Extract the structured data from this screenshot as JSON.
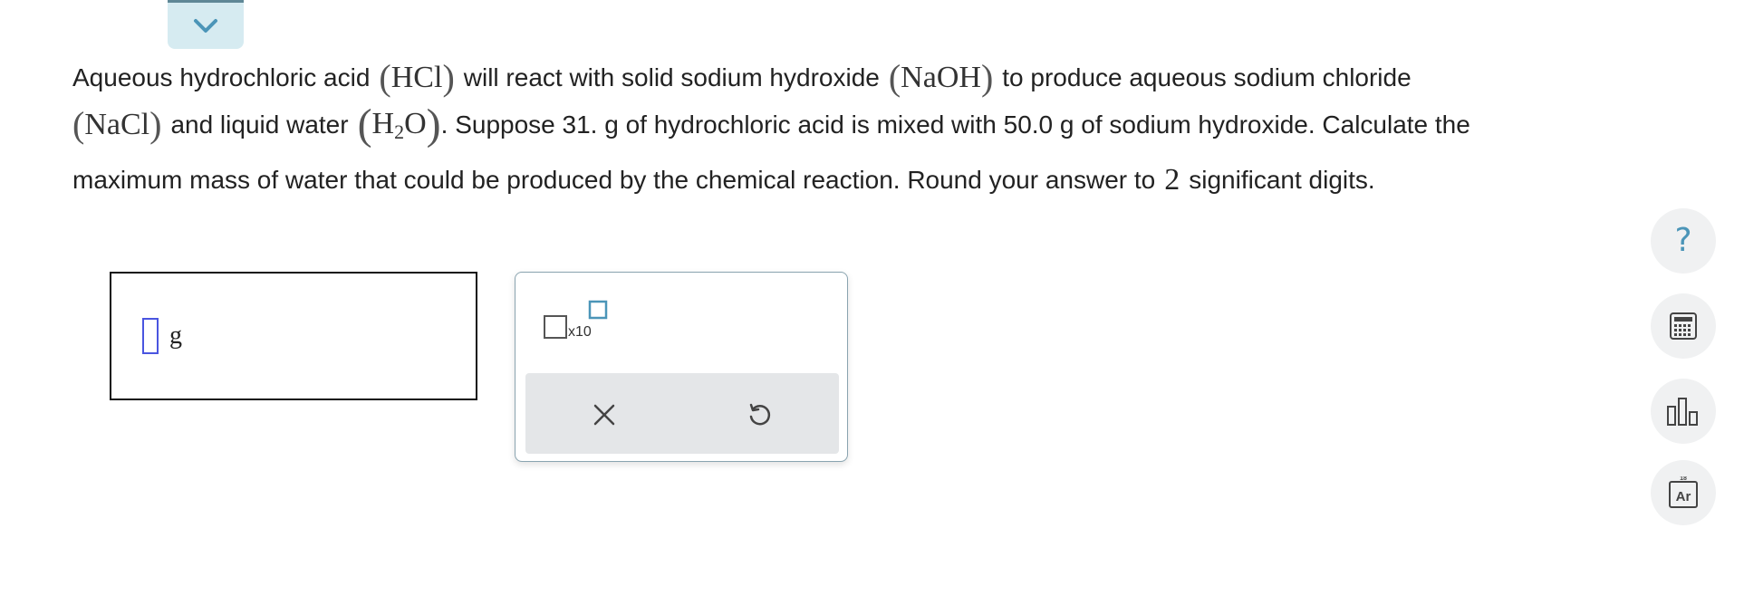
{
  "question": {
    "line1": {
      "t1": "Aqueous hydrochloric acid",
      "f1": "HCl",
      "t2": "will react with solid sodium hydroxide",
      "f2": "NaOH",
      "t3": "to produce aqueous sodium chloride"
    },
    "line2": {
      "f1": "NaCl",
      "t1": "and liquid water",
      "f2_main": "H",
      "f2_sub": "2",
      "f2_end": "O",
      "t2": ". Suppose 31. g of hydrochloric acid is mixed with 50.0 g of sodium hydroxide. Calculate the"
    },
    "line3": {
      "t1": "maximum mass of water that could be produced by the chemical reaction. Round your answer to",
      "n": "2",
      "t2": "significant digits."
    }
  },
  "answer": {
    "value": "",
    "unit": "g"
  },
  "keypad": {
    "sci_label": "x10",
    "clear_icon": "close-icon",
    "undo_icon": "undo-icon"
  },
  "tools": {
    "help_glyph": "?",
    "calculator_icon": "calculator-icon",
    "data_icon": "bar-chart-icon",
    "periodic_number": "18",
    "periodic_symbol": "Ar"
  },
  "colors": {
    "accent": "#4b95b8",
    "tab_bg": "#d6ebf1",
    "caret": "#4a55e0",
    "tool_bg": "#f0f1f2",
    "action_bar_bg": "#e4e6e8"
  }
}
